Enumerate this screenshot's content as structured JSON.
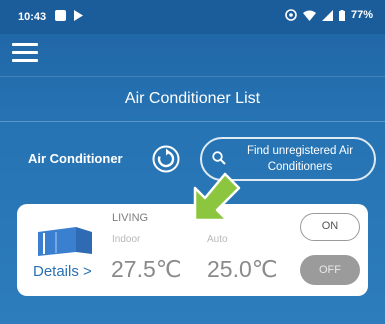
{
  "status_bar": {
    "time": "10:43",
    "battery": "77%"
  },
  "header": {
    "menu_icon": "hamburger-icon",
    "title": "Air Conditioner List"
  },
  "toolbar": {
    "section_label": "Air Conditioner",
    "refresh_icon": "refresh-icon",
    "find_button_label": "Find unregistered Air Conditioners"
  },
  "card": {
    "room_name": "LIVING",
    "indoor_label": "Indoor",
    "mode_label": "Auto",
    "indoor_temp": "27.5℃",
    "set_temp": "25.0℃",
    "details_label": "Details",
    "details_chevron": ">",
    "on_label": "ON",
    "off_label": "OFF"
  },
  "colors": {
    "background": "#2673b3",
    "status_bar": "#1b5d9b",
    "card": "#ffffff",
    "accent_link": "#2a71b4",
    "unit_icon": "#3b7fd0",
    "off_button": "#9b9b9b",
    "annotation_arrow": "#8cc63f"
  }
}
